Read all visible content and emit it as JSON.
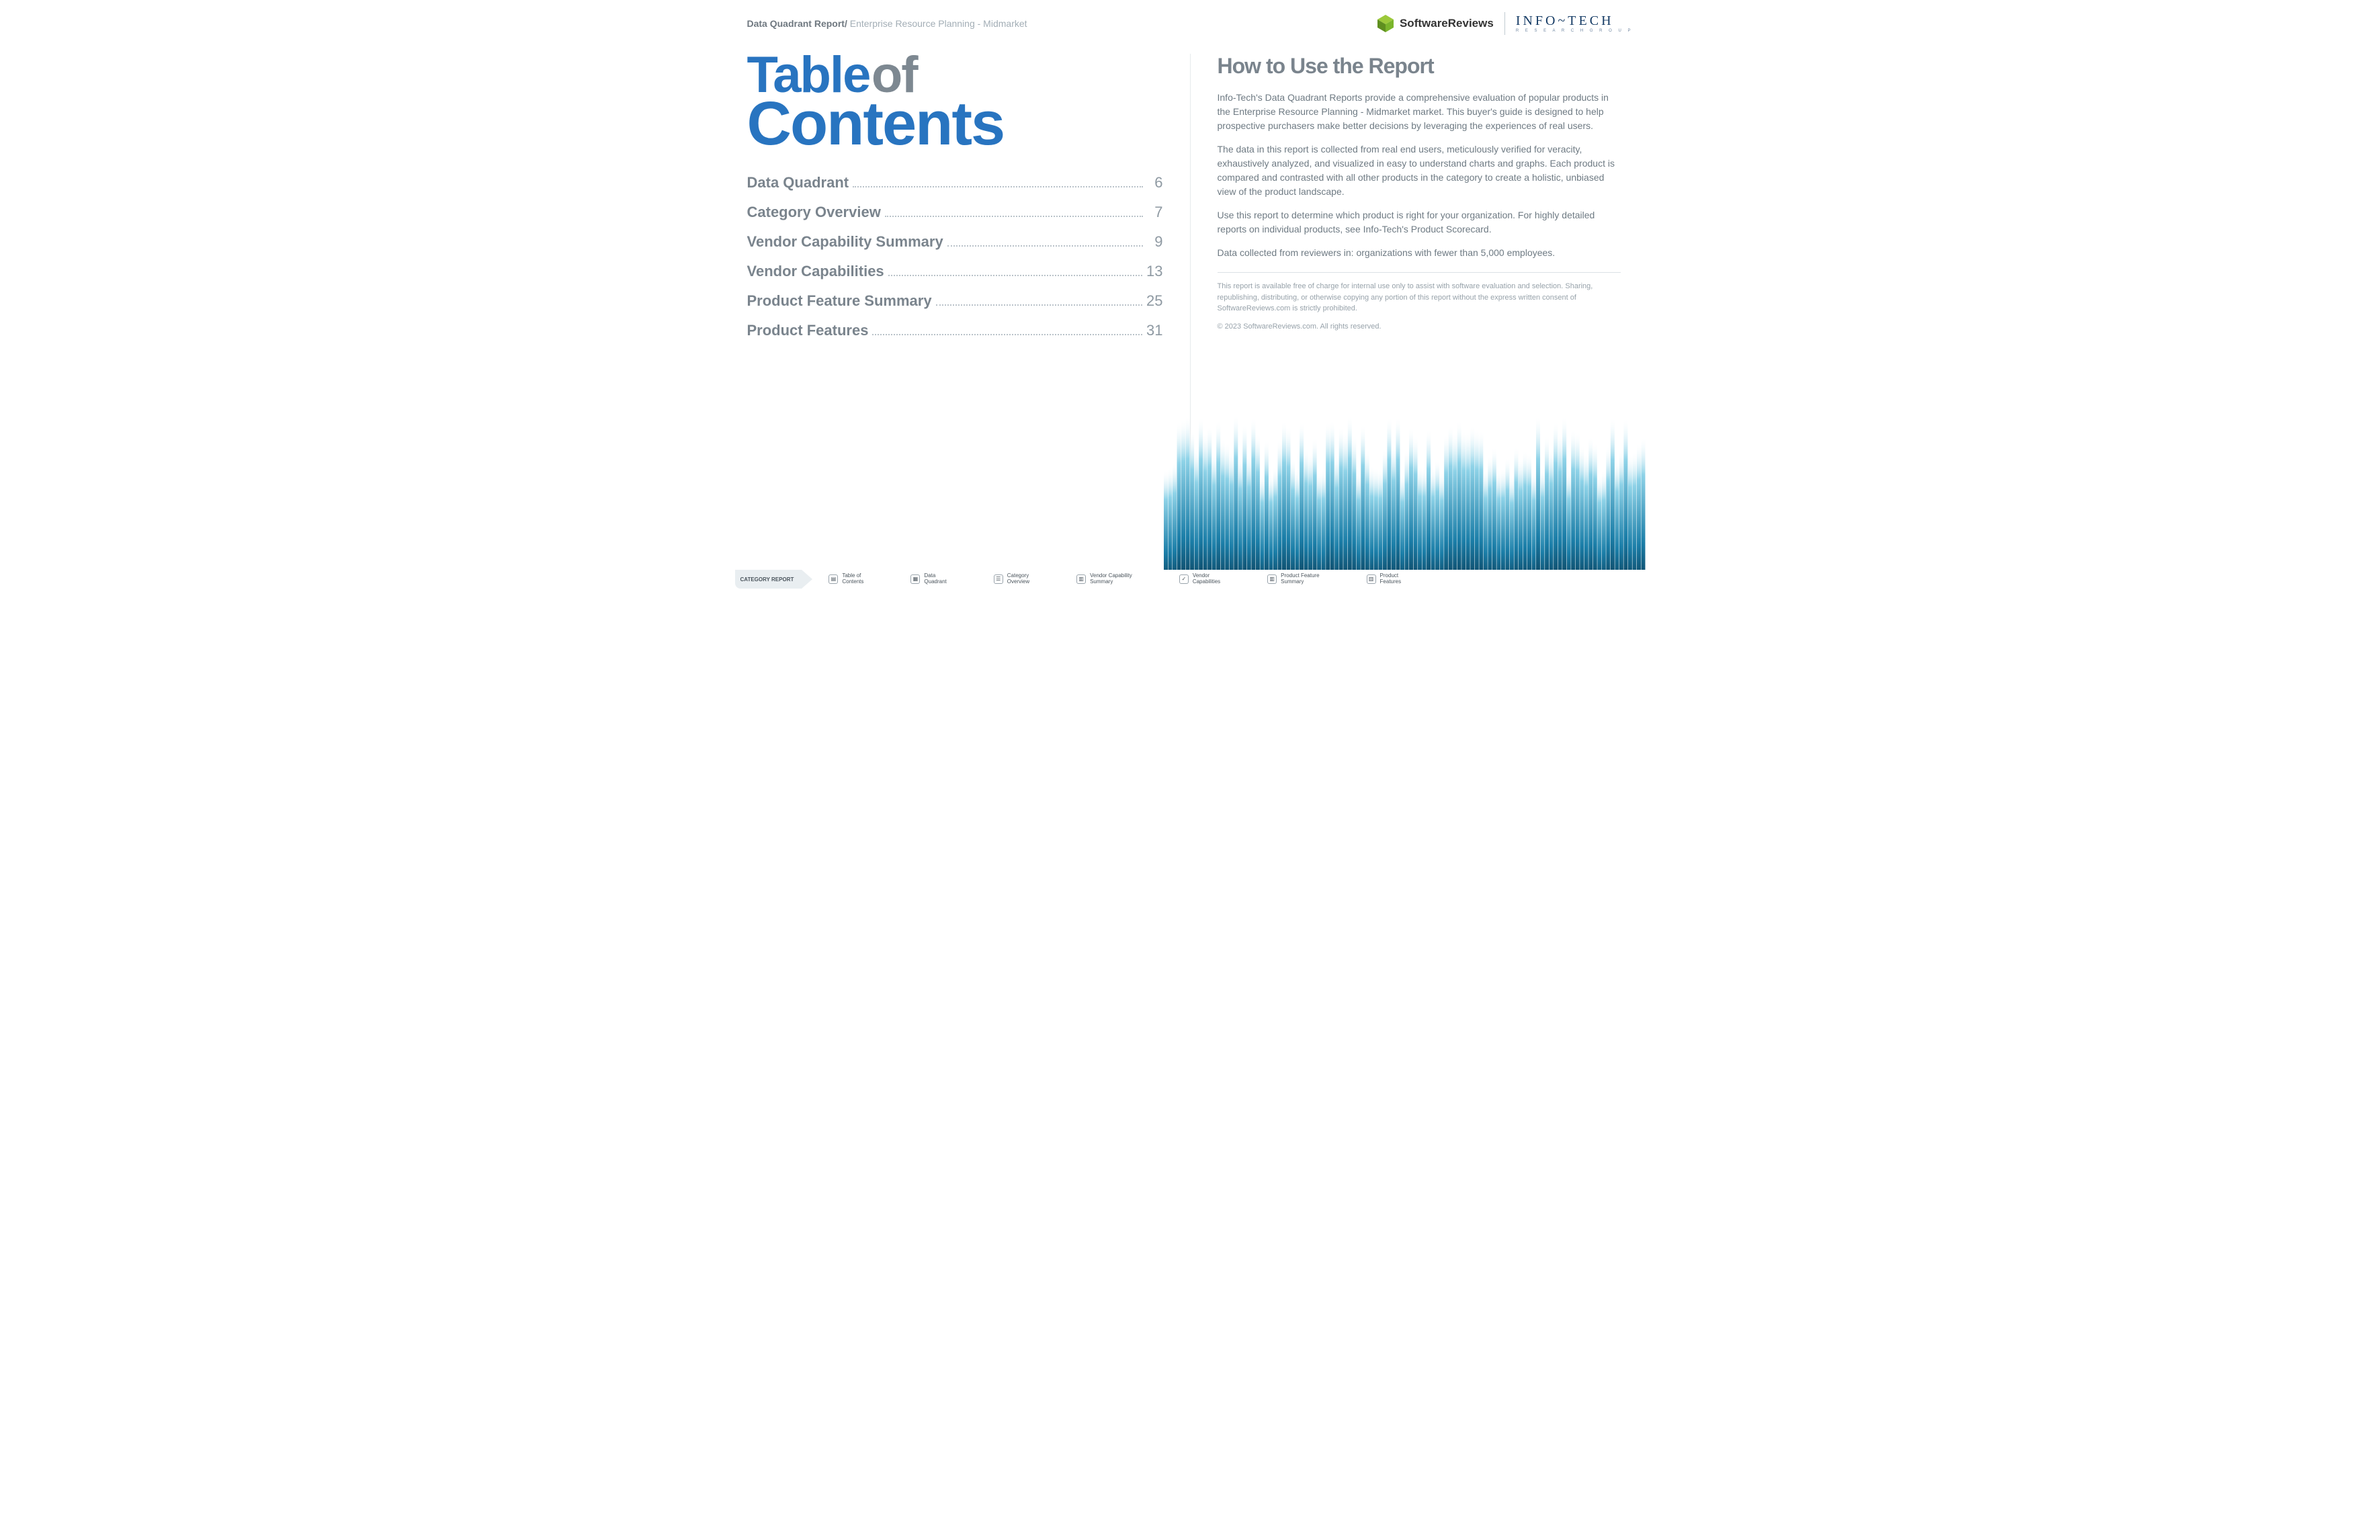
{
  "header": {
    "breadcrumb_strong": "Data Quadrant Report/",
    "breadcrumb_light": " Enterprise Resource Planning - Midmarket",
    "logo_sr": "SoftwareReviews",
    "logo_it": "INFO~TECH",
    "logo_it_sub": "R E S E A R C H   G R O U P"
  },
  "toc": {
    "title_word1": "Table",
    "title_word2": "of",
    "title_word3": "Contents",
    "items": [
      {
        "label": "Data Quadrant",
        "page": "6"
      },
      {
        "label": "Category Overview",
        "page": "7"
      },
      {
        "label": "Vendor Capability Summary",
        "page": "9"
      },
      {
        "label": "Vendor Capabilities",
        "page": "13"
      },
      {
        "label": "Product Feature Summary",
        "page": "25"
      },
      {
        "label": "Product Features",
        "page": "31"
      }
    ]
  },
  "howto": {
    "title": "How to Use the Report",
    "p1": "Info-Tech's Data Quadrant Reports provide a comprehensive evaluation of popular products in the Enterprise Resource Planning - Midmarket market. This buyer's guide is designed to help prospective purchasers make better decisions by leveraging the experiences of real users.",
    "p2": "The data in this report is collected from real end users, meticulously verified for veracity, exhaustively analyzed, and visualized in easy to understand charts and graphs. Each product is compared and contrasted with all other products in the category to create a holistic, unbiased view of the product landscape.",
    "p3": "Use this report to determine which product is right for your organization. For highly detailed reports on individual products, see Info-Tech's Product Scorecard.",
    "p4": "Data collected from reviewers in: organizations with fewer than 5,000 employees.",
    "fine1": "This report is available free of charge for internal use only to assist with software evaluation and selection. Sharing, republishing, distributing, or otherwise copying any portion of this report without the express written consent of SoftwareReviews.com is strictly prohibited.",
    "fine2": "© 2023 SoftwareReviews.com. All rights reserved."
  },
  "footer": {
    "tab": "CATEGORY REPORT",
    "items": [
      {
        "icon": "page-icon",
        "label": "Table of\nContents"
      },
      {
        "icon": "grid-icon",
        "label": "Data\nQuadrant"
      },
      {
        "icon": "list-icon",
        "label": "Category\nOverview"
      },
      {
        "icon": "table-icon",
        "label": "Vendor Capability\nSummary"
      },
      {
        "icon": "check-icon",
        "label": "Vendor\nCapabilities"
      },
      {
        "icon": "table-icon",
        "label": "Product Feature\nSummary"
      },
      {
        "icon": "table-icon",
        "label": "Product\nFeatures"
      }
    ]
  }
}
